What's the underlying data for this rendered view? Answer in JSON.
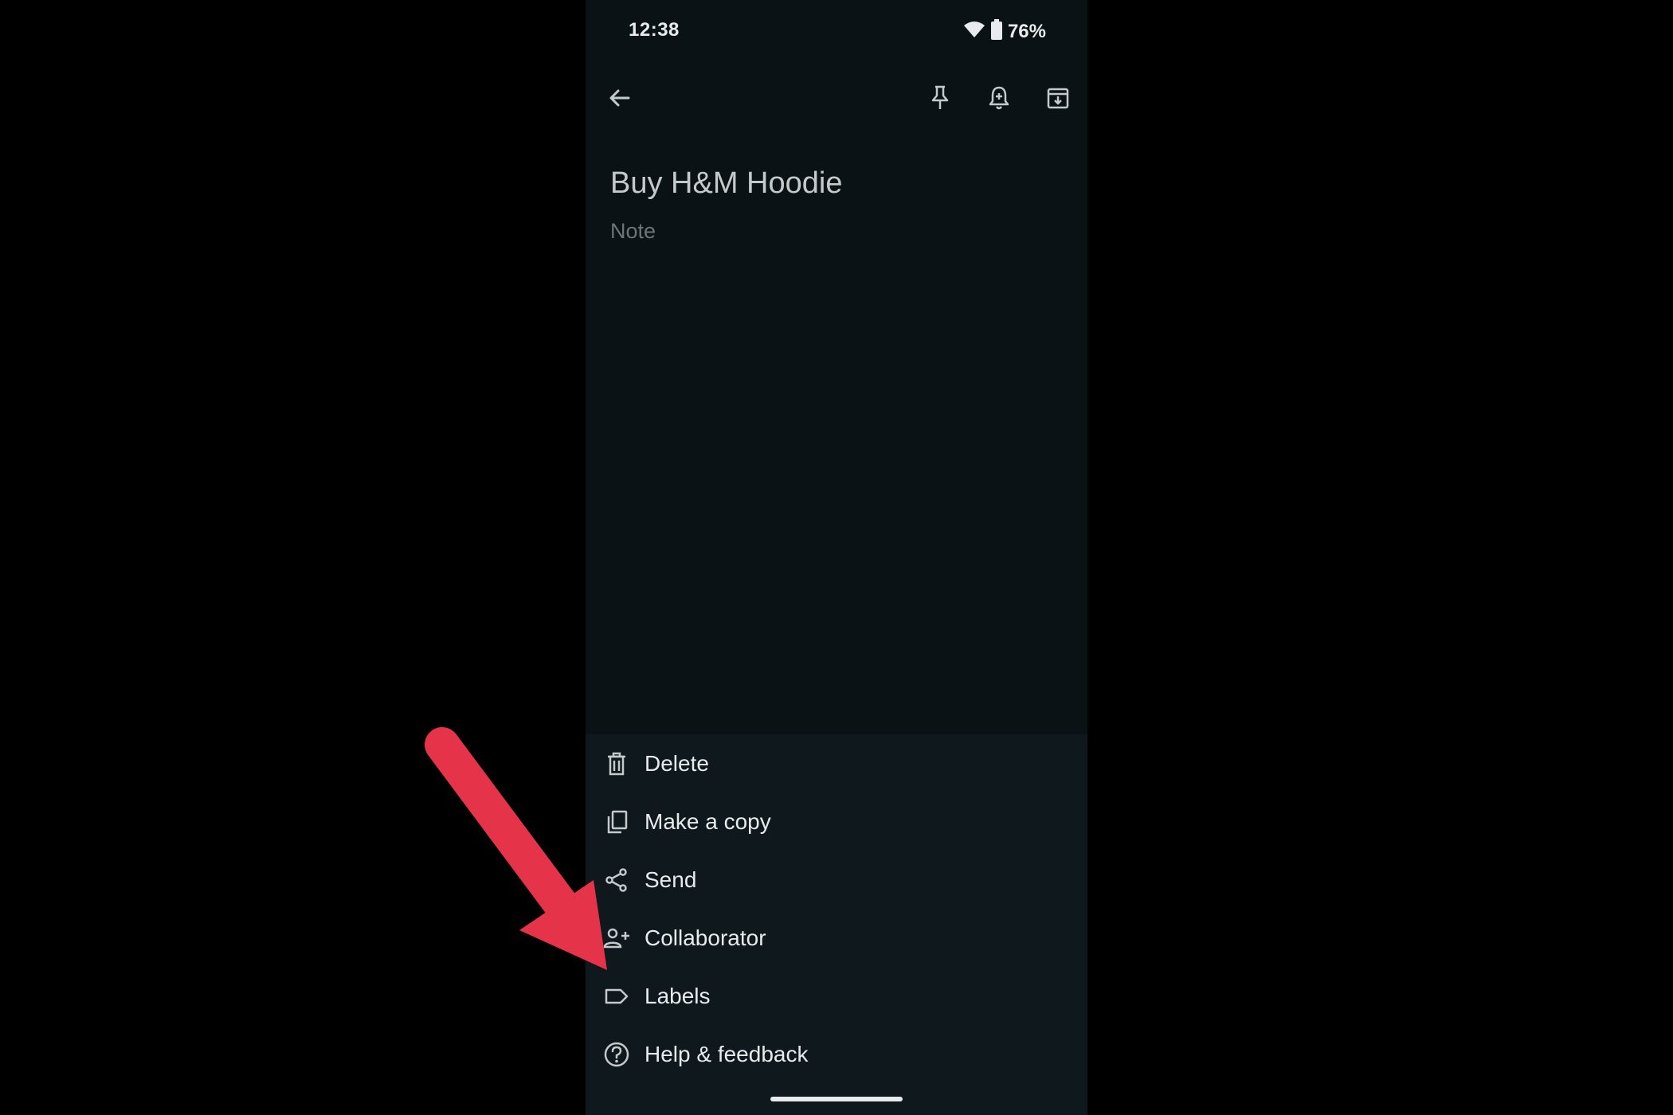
{
  "status_bar": {
    "time": "12:38",
    "battery_percent": "76%",
    "icons": [
      "wifi-icon",
      "battery-icon"
    ]
  },
  "toolbar": {
    "back_icon": "arrow-left-icon",
    "actions": [
      "pin-icon",
      "reminder-bell-icon",
      "archive-icon"
    ]
  },
  "note": {
    "title": "Buy H&M Hoodie",
    "body_placeholder": "Note"
  },
  "menu": {
    "items": [
      {
        "label": "Delete",
        "icon": "trash-icon"
      },
      {
        "label": "Make a copy",
        "icon": "copy-icon"
      },
      {
        "label": "Send",
        "icon": "share-icon"
      },
      {
        "label": "Collaborator",
        "icon": "add-person-icon"
      },
      {
        "label": "Labels",
        "icon": "label-icon"
      },
      {
        "label": "Help & feedback",
        "icon": "help-icon"
      }
    ]
  },
  "colors": {
    "background": "#0a1216",
    "menu_background": "#0f181c",
    "text_primary": "#e8eaed",
    "title_text": "#c6c9cc",
    "placeholder_text": "#6f7478",
    "annotation_arrow": "#e5344a"
  }
}
